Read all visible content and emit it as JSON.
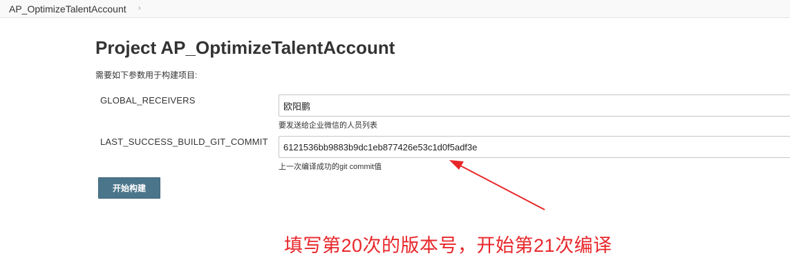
{
  "breadcrumb": {
    "project_link": "AP_OptimizeTalentAccount",
    "chevron": "›"
  },
  "page": {
    "title": "Project AP_OptimizeTalentAccount",
    "description": "需要如下参数用于构建项目:"
  },
  "parameters": [
    {
      "name": "GLOBAL_RECEIVERS",
      "value": "欧阳鹏",
      "help": "要发送给企业微信的人员列表"
    },
    {
      "name": "LAST_SUCCESS_BUILD_GIT_COMMIT",
      "value": "6121536bb9883b9dc1eb877426e53c1d0f5adf3e",
      "help": "上一次编译成功的git commit值"
    }
  ],
  "build_button": {
    "label": "开始构建"
  },
  "annotation": {
    "text": "填写第20次的版本号，开始第21次编译",
    "color": "#e8262a"
  }
}
